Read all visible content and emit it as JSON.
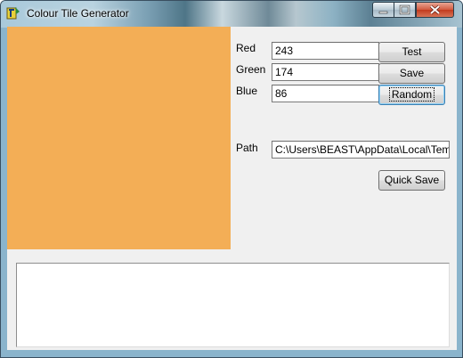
{
  "window": {
    "title": "Colour Tile Generator",
    "icon": "app-icon"
  },
  "titlebar_buttons": {
    "minimize_icon": "minimize-icon",
    "maximize_icon": "maximize-icon",
    "close_icon": "close-icon"
  },
  "tile": {
    "color": "#f3ae56"
  },
  "fields": {
    "red_label": "Red",
    "red_value": "243",
    "green_label": "Green",
    "green_value": "174",
    "blue_label": "Blue",
    "blue_value": "86",
    "path_label": "Path",
    "path_value": "C:\\Users\\BEAST\\AppData\\Local\\Temp"
  },
  "buttons": {
    "test": "Test",
    "save": "Save",
    "random": "Random",
    "quick_save": "Quick Save"
  },
  "log": {
    "text": ""
  }
}
